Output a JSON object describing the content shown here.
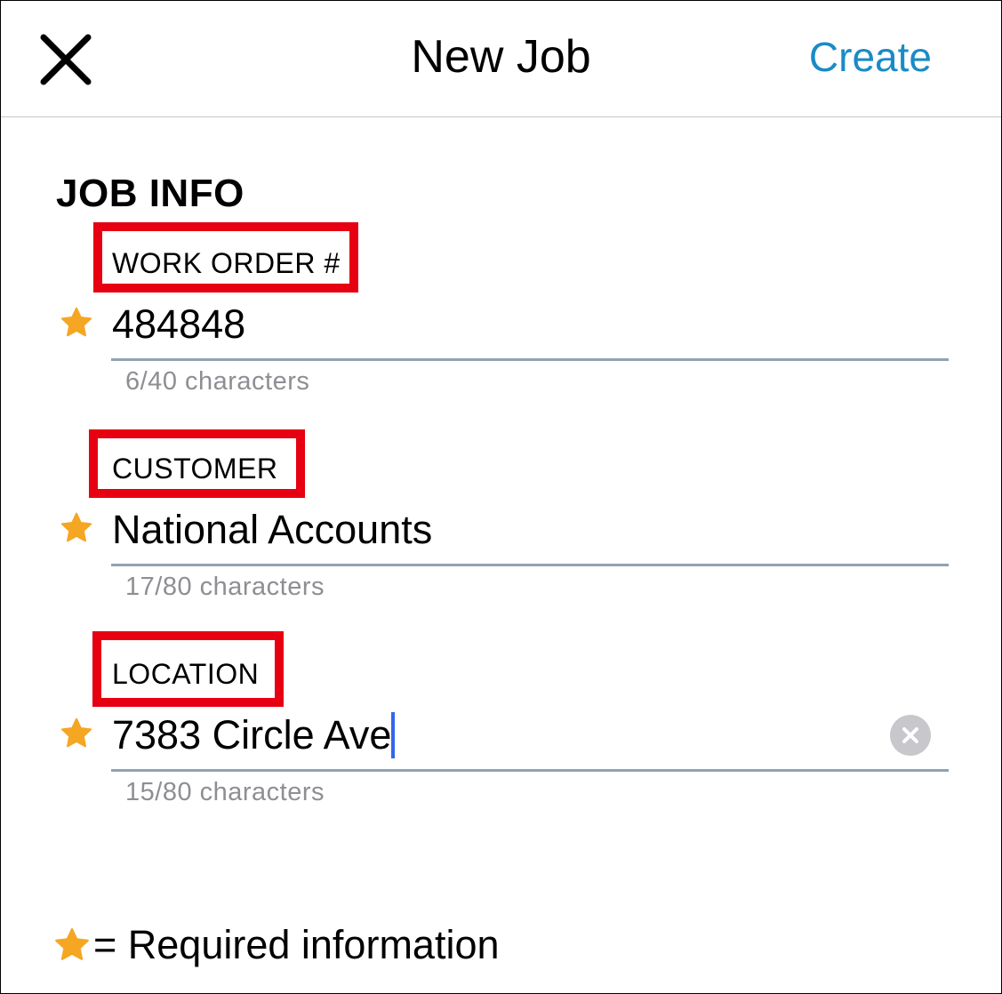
{
  "header": {
    "close_icon": "close-icon",
    "title": "New Job",
    "create_label": "Create",
    "accent_color": "#1a8bc6"
  },
  "section": {
    "title": "JOB INFO"
  },
  "fields": [
    {
      "label": "WORK ORDER #",
      "value": "484848",
      "counter": "6/40 characters",
      "required": true
    },
    {
      "label": "CUSTOMER",
      "value": "National Accounts",
      "counter": "17/80 characters",
      "required": true
    },
    {
      "label": "LOCATION",
      "value": "7383 Circle Ave",
      "counter": "15/80 characters",
      "required": true,
      "focused": true
    }
  ],
  "footer": {
    "legend_icon": "star-icon",
    "legend_text": "= Required information"
  },
  "colors": {
    "star": "#f5a623",
    "highlight": "#e60012",
    "caret": "#3366ee"
  }
}
